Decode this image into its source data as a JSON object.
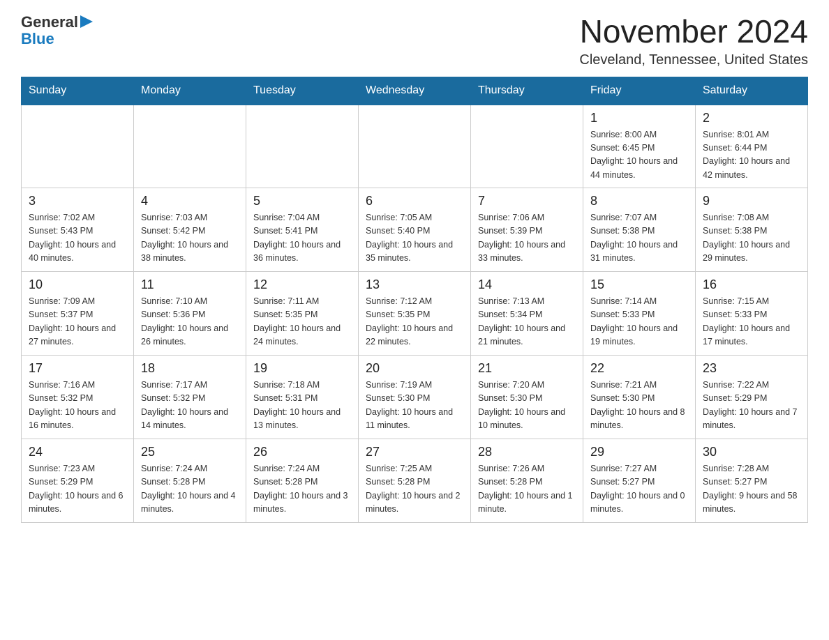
{
  "logo": {
    "text_general": "General",
    "text_blue": "Blue"
  },
  "calendar": {
    "title": "November 2024",
    "subtitle": "Cleveland, Tennessee, United States",
    "days_of_week": [
      "Sunday",
      "Monday",
      "Tuesday",
      "Wednesday",
      "Thursday",
      "Friday",
      "Saturday"
    ],
    "weeks": [
      [
        {
          "day": "",
          "info": ""
        },
        {
          "day": "",
          "info": ""
        },
        {
          "day": "",
          "info": ""
        },
        {
          "day": "",
          "info": ""
        },
        {
          "day": "",
          "info": ""
        },
        {
          "day": "1",
          "info": "Sunrise: 8:00 AM\nSunset: 6:45 PM\nDaylight: 10 hours\nand 44 minutes."
        },
        {
          "day": "2",
          "info": "Sunrise: 8:01 AM\nSunset: 6:44 PM\nDaylight: 10 hours\nand 42 minutes."
        }
      ],
      [
        {
          "day": "3",
          "info": "Sunrise: 7:02 AM\nSunset: 5:43 PM\nDaylight: 10 hours\nand 40 minutes."
        },
        {
          "day": "4",
          "info": "Sunrise: 7:03 AM\nSunset: 5:42 PM\nDaylight: 10 hours\nand 38 minutes."
        },
        {
          "day": "5",
          "info": "Sunrise: 7:04 AM\nSunset: 5:41 PM\nDaylight: 10 hours\nand 36 minutes."
        },
        {
          "day": "6",
          "info": "Sunrise: 7:05 AM\nSunset: 5:40 PM\nDaylight: 10 hours\nand 35 minutes."
        },
        {
          "day": "7",
          "info": "Sunrise: 7:06 AM\nSunset: 5:39 PM\nDaylight: 10 hours\nand 33 minutes."
        },
        {
          "day": "8",
          "info": "Sunrise: 7:07 AM\nSunset: 5:38 PM\nDaylight: 10 hours\nand 31 minutes."
        },
        {
          "day": "9",
          "info": "Sunrise: 7:08 AM\nSunset: 5:38 PM\nDaylight: 10 hours\nand 29 minutes."
        }
      ],
      [
        {
          "day": "10",
          "info": "Sunrise: 7:09 AM\nSunset: 5:37 PM\nDaylight: 10 hours\nand 27 minutes."
        },
        {
          "day": "11",
          "info": "Sunrise: 7:10 AM\nSunset: 5:36 PM\nDaylight: 10 hours\nand 26 minutes."
        },
        {
          "day": "12",
          "info": "Sunrise: 7:11 AM\nSunset: 5:35 PM\nDaylight: 10 hours\nand 24 minutes."
        },
        {
          "day": "13",
          "info": "Sunrise: 7:12 AM\nSunset: 5:35 PM\nDaylight: 10 hours\nand 22 minutes."
        },
        {
          "day": "14",
          "info": "Sunrise: 7:13 AM\nSunset: 5:34 PM\nDaylight: 10 hours\nand 21 minutes."
        },
        {
          "day": "15",
          "info": "Sunrise: 7:14 AM\nSunset: 5:33 PM\nDaylight: 10 hours\nand 19 minutes."
        },
        {
          "day": "16",
          "info": "Sunrise: 7:15 AM\nSunset: 5:33 PM\nDaylight: 10 hours\nand 17 minutes."
        }
      ],
      [
        {
          "day": "17",
          "info": "Sunrise: 7:16 AM\nSunset: 5:32 PM\nDaylight: 10 hours\nand 16 minutes."
        },
        {
          "day": "18",
          "info": "Sunrise: 7:17 AM\nSunset: 5:32 PM\nDaylight: 10 hours\nand 14 minutes."
        },
        {
          "day": "19",
          "info": "Sunrise: 7:18 AM\nSunset: 5:31 PM\nDaylight: 10 hours\nand 13 minutes."
        },
        {
          "day": "20",
          "info": "Sunrise: 7:19 AM\nSunset: 5:30 PM\nDaylight: 10 hours\nand 11 minutes."
        },
        {
          "day": "21",
          "info": "Sunrise: 7:20 AM\nSunset: 5:30 PM\nDaylight: 10 hours\nand 10 minutes."
        },
        {
          "day": "22",
          "info": "Sunrise: 7:21 AM\nSunset: 5:30 PM\nDaylight: 10 hours\nand 8 minutes."
        },
        {
          "day": "23",
          "info": "Sunrise: 7:22 AM\nSunset: 5:29 PM\nDaylight: 10 hours\nand 7 minutes."
        }
      ],
      [
        {
          "day": "24",
          "info": "Sunrise: 7:23 AM\nSunset: 5:29 PM\nDaylight: 10 hours\nand 6 minutes."
        },
        {
          "day": "25",
          "info": "Sunrise: 7:24 AM\nSunset: 5:28 PM\nDaylight: 10 hours\nand 4 minutes."
        },
        {
          "day": "26",
          "info": "Sunrise: 7:24 AM\nSunset: 5:28 PM\nDaylight: 10 hours\nand 3 minutes."
        },
        {
          "day": "27",
          "info": "Sunrise: 7:25 AM\nSunset: 5:28 PM\nDaylight: 10 hours\nand 2 minutes."
        },
        {
          "day": "28",
          "info": "Sunrise: 7:26 AM\nSunset: 5:28 PM\nDaylight: 10 hours\nand 1 minute."
        },
        {
          "day": "29",
          "info": "Sunrise: 7:27 AM\nSunset: 5:27 PM\nDaylight: 10 hours\nand 0 minutes."
        },
        {
          "day": "30",
          "info": "Sunrise: 7:28 AM\nSunset: 5:27 PM\nDaylight: 9 hours\nand 58 minutes."
        }
      ]
    ]
  }
}
